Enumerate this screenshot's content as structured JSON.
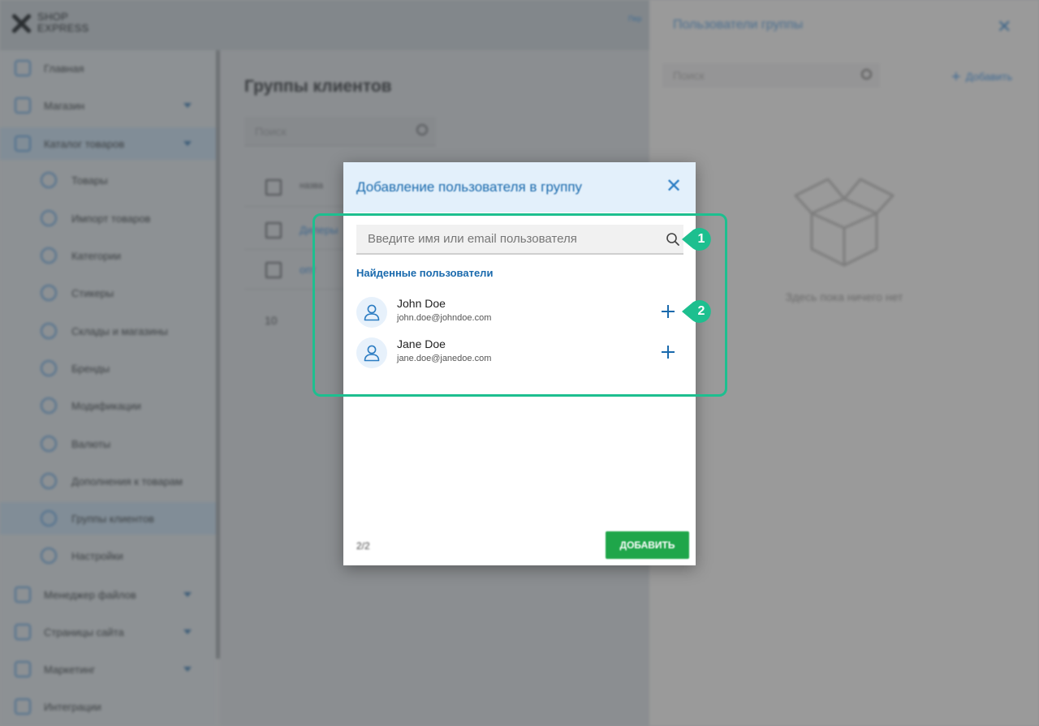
{
  "app": {
    "logo_line1": "SHOP",
    "logo_line2": "EXPRESS",
    "topbar_link": "Пер"
  },
  "sidebar": {
    "items": [
      {
        "label": "Главная",
        "icon": "home-icon"
      },
      {
        "label": "Магазин",
        "icon": "cart-icon"
      },
      {
        "label": "Каталог товаров",
        "icon": "book-icon"
      },
      {
        "label": "Товары",
        "icon": "box-icon"
      },
      {
        "label": "Импорт товаров",
        "icon": "download-icon"
      },
      {
        "label": "Категории",
        "icon": "grid-icon"
      },
      {
        "label": "Стикеры",
        "icon": "sticker-icon"
      },
      {
        "label": "Склады и магазины",
        "icon": "warehouse-icon"
      },
      {
        "label": "Бренды",
        "icon": "tag-icon"
      },
      {
        "label": "Модификации",
        "icon": "bookmark-icon"
      },
      {
        "label": "Валюты",
        "icon": "currency-icon"
      },
      {
        "label": "Дополнения к товарам",
        "icon": "plus-circle-icon"
      },
      {
        "label": "Группы клиентов",
        "icon": "users-icon"
      },
      {
        "label": "Настройки",
        "icon": "gear-icon"
      },
      {
        "label": "Менеджер файлов",
        "icon": "folder-icon"
      },
      {
        "label": "Страницы сайта",
        "icon": "pages-icon"
      },
      {
        "label": "Маркетинг",
        "icon": "marketing-icon"
      },
      {
        "label": "Интеграции",
        "icon": "plug-icon"
      }
    ]
  },
  "main": {
    "title": "Группы клиентов",
    "search_placeholder": "Поиск",
    "table": {
      "header": "назва",
      "rows": [
        "Дилеры",
        "опт"
      ]
    },
    "page_size": "10"
  },
  "right_panel": {
    "title": "Пользователи группы",
    "search_placeholder": "Поиск",
    "add_label": "Добавить",
    "empty_text": "Здесь пока ничего нет"
  },
  "dialog": {
    "title": "Добавление пользователя в группу",
    "search_placeholder": "Введите имя или email пользователя",
    "found_label": "Найденные пользователи",
    "users": [
      {
        "name": "John Doe",
        "email": "john.doe@johndoe.com"
      },
      {
        "name": "Jane Doe",
        "email": "jane.doe@janedoe.com"
      }
    ],
    "count": "2/2",
    "add_button": "ДОБАВИТЬ"
  },
  "annotations": {
    "markers": [
      "1",
      "2"
    ],
    "color": "#1dbf8f"
  },
  "colors": {
    "accent": "#1a6aad",
    "success": "#1fa64a"
  }
}
